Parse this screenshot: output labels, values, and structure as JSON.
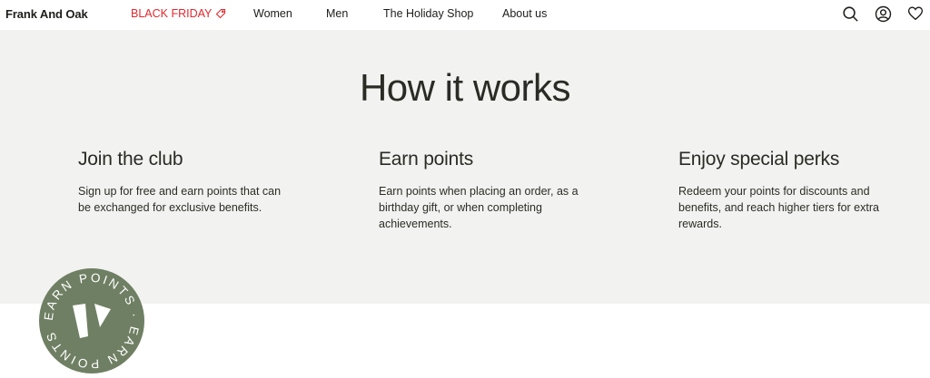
{
  "nav": {
    "logo": "Frank And Oak",
    "black_friday": "BLACK FRIDAY",
    "women": "Women",
    "men": "Men",
    "holiday_shop": "The Holiday Shop",
    "about": "About us",
    "icons": [
      "search-icon",
      "account-icon",
      "heart-icon"
    ],
    "sale_color": "#e3272b"
  },
  "hero": {
    "title": "How it works",
    "steps": [
      {
        "title": "Join the club",
        "body": "Sign up for free and earn points that can be exchanged for exclusive benefits."
      },
      {
        "title": "Earn points",
        "body": "Earn points when placing an order, as a birthday gift, or when completing achievements."
      },
      {
        "title": "Enjoy special perks",
        "body": "Redeem your points for discounts and benefits, and reach higher tiers for extra rewards."
      }
    ]
  },
  "badge": {
    "text": "EARN POINTS · EARN POINTS ·",
    "color": "#6f7f63"
  }
}
